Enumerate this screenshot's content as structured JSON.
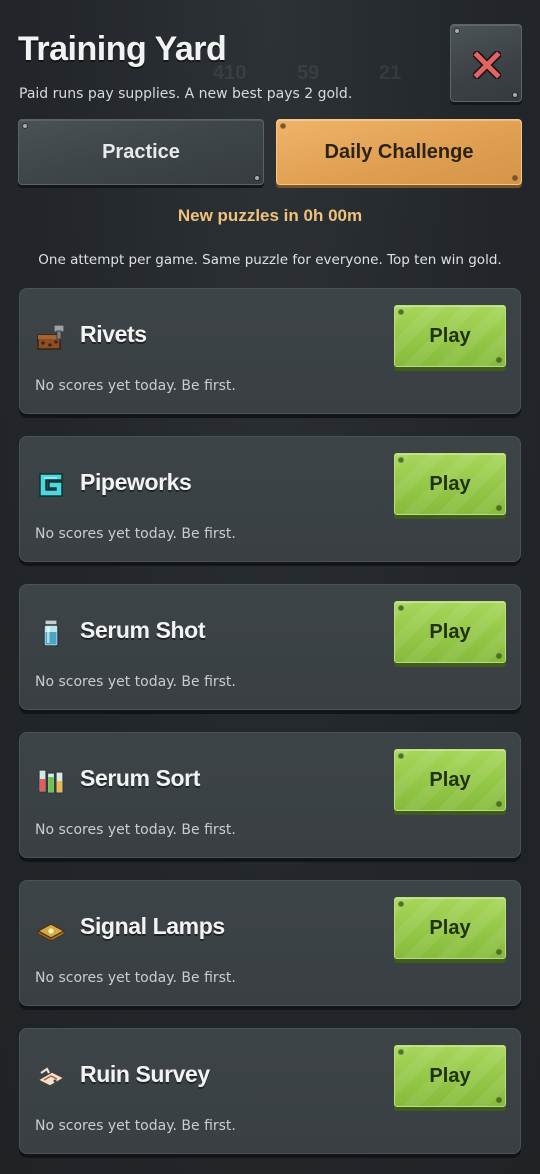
{
  "header": {
    "title": "Training Yard",
    "subtitle": "Paid runs pay supplies. A new best pays 2 gold.",
    "hud_ghost": [
      "410",
      "59",
      "21"
    ]
  },
  "close_button": {
    "icon": "close-icon",
    "color": "#e06060"
  },
  "tabs": [
    {
      "label": "Practice",
      "selected": false
    },
    {
      "label": "Daily Challenge",
      "selected": true
    }
  ],
  "countdown": "New puzzles in 0h 00m",
  "rules": "One attempt per game. Same puzzle for everyone. Top ten win gold.",
  "games": [
    {
      "name": "Rivets",
      "icon": "rivets-crate-icon",
      "status": "No scores yet today. Be first.",
      "play_label": "Play"
    },
    {
      "name": "Pipeworks",
      "icon": "pipe-ring-icon",
      "status": "No scores yet today. Be first.",
      "play_label": "Play"
    },
    {
      "name": "Serum Shot",
      "icon": "serum-vial-icon",
      "status": "No scores yet today. Be first.",
      "play_label": "Play"
    },
    {
      "name": "Serum Sort",
      "icon": "serum-rack-icon",
      "status": "No scores yet today. Be first.",
      "play_label": "Play"
    },
    {
      "name": "Signal Lamps",
      "icon": "signal-lamp-icon",
      "status": "No scores yet today. Be first.",
      "play_label": "Play"
    },
    {
      "name": "Ruin Survey",
      "icon": "survey-map-icon",
      "status": "No scores yet today. Be first.",
      "play_label": "Play"
    }
  ],
  "colors": {
    "accent": "#e0a052",
    "play": "#92c646",
    "countdown": "#f0c27b"
  }
}
